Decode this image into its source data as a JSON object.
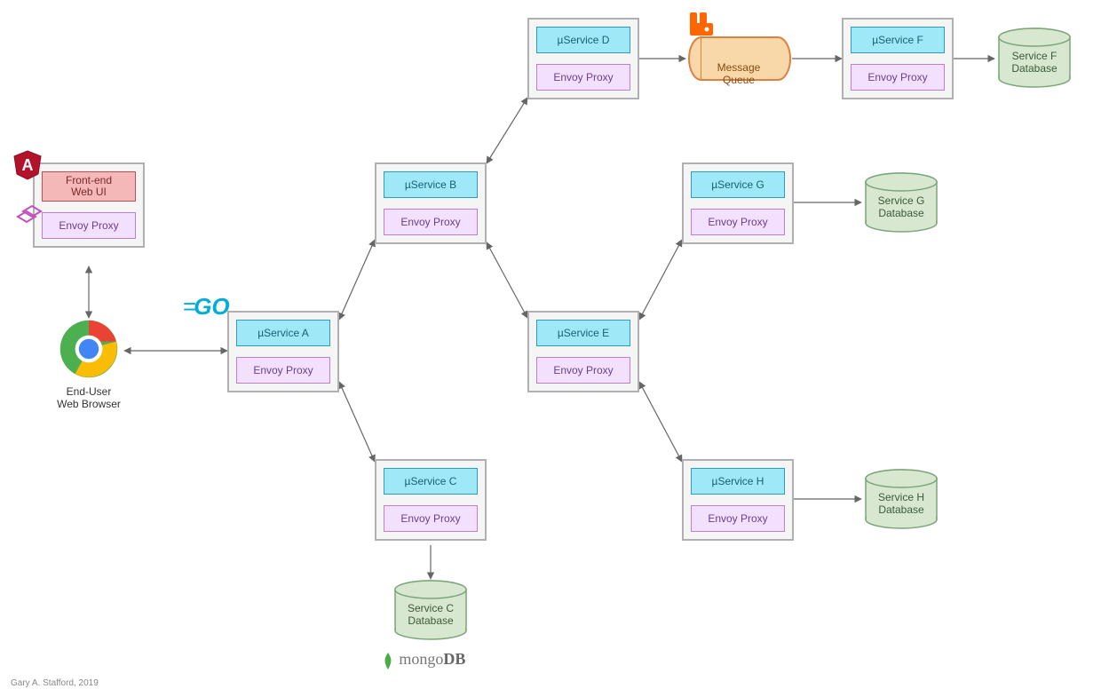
{
  "frontend": {
    "title": "Front-end\nWeb UI",
    "proxy_label": "Envoy Proxy"
  },
  "browser": {
    "label": "End-User\nWeb Browser"
  },
  "services": {
    "A": {
      "label": "µService A",
      "proxy": "Envoy Proxy"
    },
    "B": {
      "label": "µService B",
      "proxy": "Envoy Proxy"
    },
    "C": {
      "label": "µService C",
      "proxy": "Envoy Proxy"
    },
    "D": {
      "label": "µService D",
      "proxy": "Envoy Proxy"
    },
    "E": {
      "label": "µService E",
      "proxy": "Envoy Proxy"
    },
    "F": {
      "label": "µService F",
      "proxy": "Envoy Proxy"
    },
    "G": {
      "label": "µService G",
      "proxy": "Envoy Proxy"
    },
    "H": {
      "label": "µService H",
      "proxy": "Envoy Proxy"
    }
  },
  "mq": {
    "label": "Message\nQueue"
  },
  "databases": {
    "C": {
      "label": "Service C\nDatabase"
    },
    "F": {
      "label": "Service F\nDatabase"
    },
    "G": {
      "label": "Service G\nDatabase"
    },
    "H": {
      "label": "Service H\nDatabase"
    }
  },
  "logos": {
    "angular": "angular-icon",
    "envoy": "envoy-icon",
    "chrome": "chrome-icon",
    "golang": "golang-icon",
    "rabbitmq": "rabbitmq-icon",
    "mongodb_text": "mongoDB"
  },
  "credit": "Gary A. Stafford, 2019",
  "colors": {
    "pod_border": "#b0b0b0",
    "pod_fill": "#f5f5f5",
    "svc_fill": "#9fe8f7",
    "svc_border": "#2f9bc1",
    "proxy_fill": "#f3e0ff",
    "proxy_border": "#b97fd9",
    "db_fill": "#d8e8d0",
    "db_border": "#7aa57a",
    "mq_fill": "#f8d8a8",
    "mq_border": "#e08040",
    "frontend_fill": "#f4b8b8",
    "frontend_border": "#c05050"
  },
  "chart_data": {
    "type": "diagram",
    "nodes": [
      {
        "id": "browser",
        "kind": "client",
        "label": "End-User Web Browser"
      },
      {
        "id": "frontend",
        "kind": "pod",
        "boxes": [
          "Front-end Web UI",
          "Envoy Proxy"
        ]
      },
      {
        "id": "svcA",
        "kind": "pod",
        "boxes": [
          "µService A",
          "Envoy Proxy"
        ]
      },
      {
        "id": "svcB",
        "kind": "pod",
        "boxes": [
          "µService B",
          "Envoy Proxy"
        ]
      },
      {
        "id": "svcC",
        "kind": "pod",
        "boxes": [
          "µService C",
          "Envoy Proxy"
        ]
      },
      {
        "id": "svcD",
        "kind": "pod",
        "boxes": [
          "µService D",
          "Envoy Proxy"
        ]
      },
      {
        "id": "svcE",
        "kind": "pod",
        "boxes": [
          "µService E",
          "Envoy Proxy"
        ]
      },
      {
        "id": "svcF",
        "kind": "pod",
        "boxes": [
          "µService F",
          "Envoy Proxy"
        ]
      },
      {
        "id": "svcG",
        "kind": "pod",
        "boxes": [
          "µService G",
          "Envoy Proxy"
        ]
      },
      {
        "id": "svcH",
        "kind": "pod",
        "boxes": [
          "µService H",
          "Envoy Proxy"
        ]
      },
      {
        "id": "mq",
        "kind": "queue",
        "label": "Message Queue"
      },
      {
        "id": "dbC",
        "kind": "database",
        "label": "Service C Database"
      },
      {
        "id": "dbF",
        "kind": "database",
        "label": "Service F Database"
      },
      {
        "id": "dbG",
        "kind": "database",
        "label": "Service G Database"
      },
      {
        "id": "dbH",
        "kind": "database",
        "label": "Service H Database"
      }
    ],
    "edges": [
      {
        "from": "browser",
        "to": "frontend",
        "dir": "both"
      },
      {
        "from": "browser",
        "to": "svcA",
        "dir": "both"
      },
      {
        "from": "svcA",
        "to": "svcB",
        "dir": "both"
      },
      {
        "from": "svcA",
        "to": "svcC",
        "dir": "both"
      },
      {
        "from": "svcB",
        "to": "svcD",
        "dir": "both"
      },
      {
        "from": "svcB",
        "to": "svcE",
        "dir": "both"
      },
      {
        "from": "svcD",
        "to": "mq",
        "dir": "forward"
      },
      {
        "from": "mq",
        "to": "svcF",
        "dir": "forward"
      },
      {
        "from": "svcF",
        "to": "dbF",
        "dir": "forward"
      },
      {
        "from": "svcE",
        "to": "svcG",
        "dir": "both"
      },
      {
        "from": "svcE",
        "to": "svcH",
        "dir": "both"
      },
      {
        "from": "svcG",
        "to": "dbG",
        "dir": "forward"
      },
      {
        "from": "svcH",
        "to": "dbH",
        "dir": "forward"
      },
      {
        "from": "svcC",
        "to": "dbC",
        "dir": "forward"
      }
    ]
  }
}
